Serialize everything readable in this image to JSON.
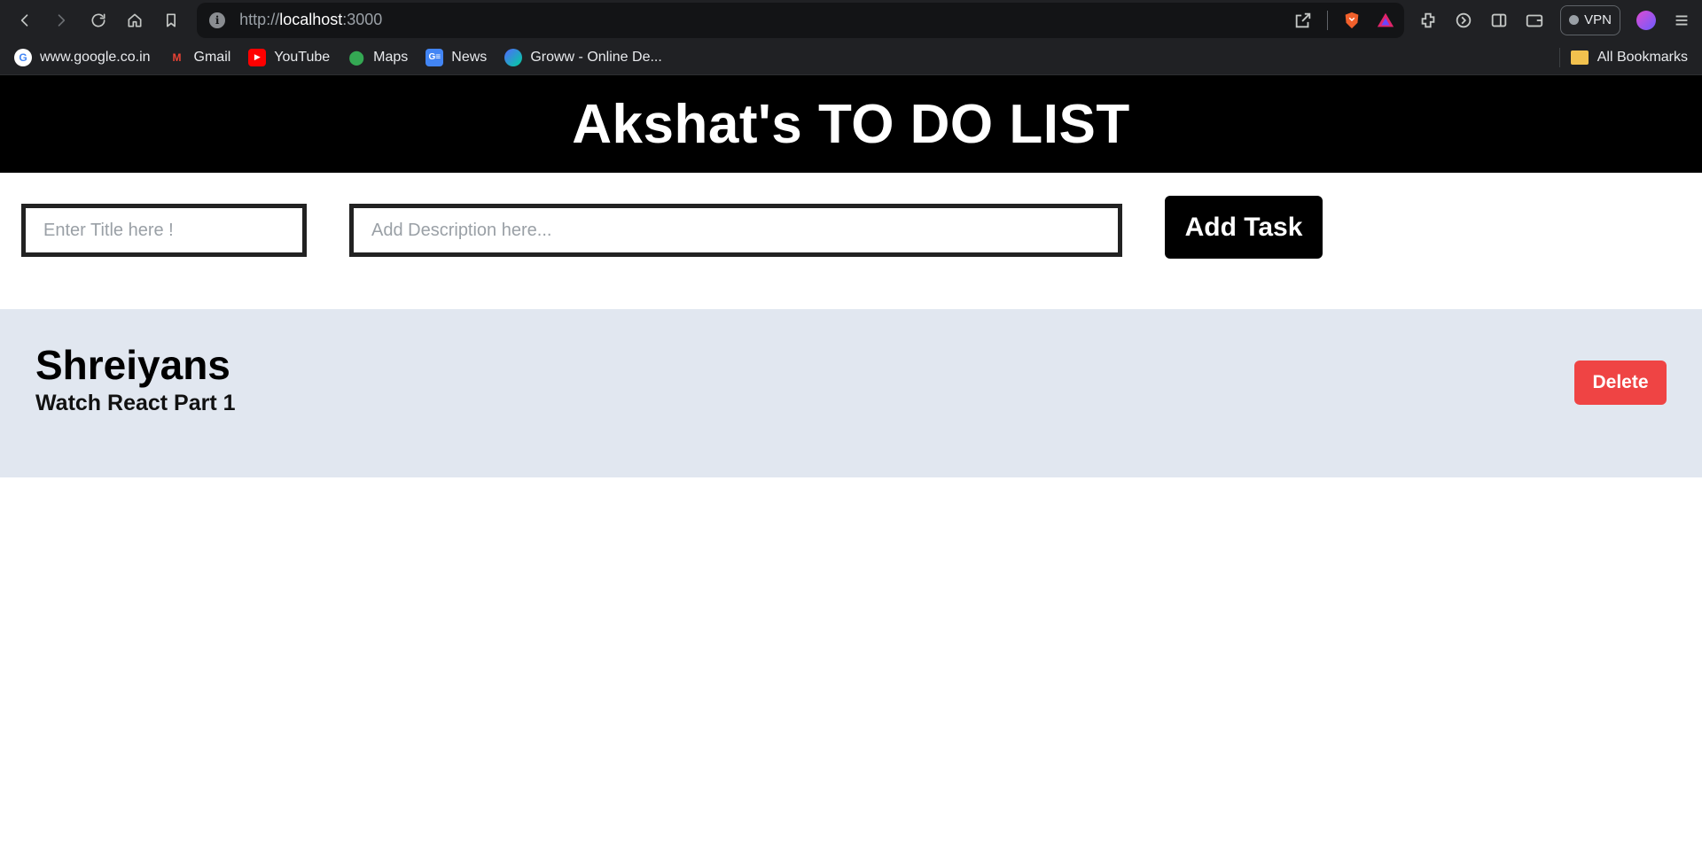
{
  "browser": {
    "url_scheme": "http://",
    "url_host": "localhost",
    "url_port": ":3000",
    "vpn_label": "VPN",
    "bookmarks": [
      {
        "label": "www.google.co.in",
        "icon": "google-icon"
      },
      {
        "label": "Gmail",
        "icon": "gmail-icon"
      },
      {
        "label": "YouTube",
        "icon": "youtube-icon"
      },
      {
        "label": "Maps",
        "icon": "maps-icon"
      },
      {
        "label": "News",
        "icon": "news-icon"
      },
      {
        "label": "Groww - Online De...",
        "icon": "groww-icon"
      }
    ],
    "all_bookmarks_label": "All Bookmarks"
  },
  "app": {
    "title": "Akshat's TO DO LIST",
    "title_placeholder": "Enter Title here !",
    "description_placeholder": "Add Description here...",
    "add_button_label": "Add Task",
    "tasks": [
      {
        "title": "Shreiyans",
        "description": "Watch React Part 1",
        "delete_label": "Delete"
      }
    ]
  },
  "colors": {
    "header_bg": "#000000",
    "task_band_bg": "#e1e7f0",
    "delete_bg": "#ef4444"
  }
}
